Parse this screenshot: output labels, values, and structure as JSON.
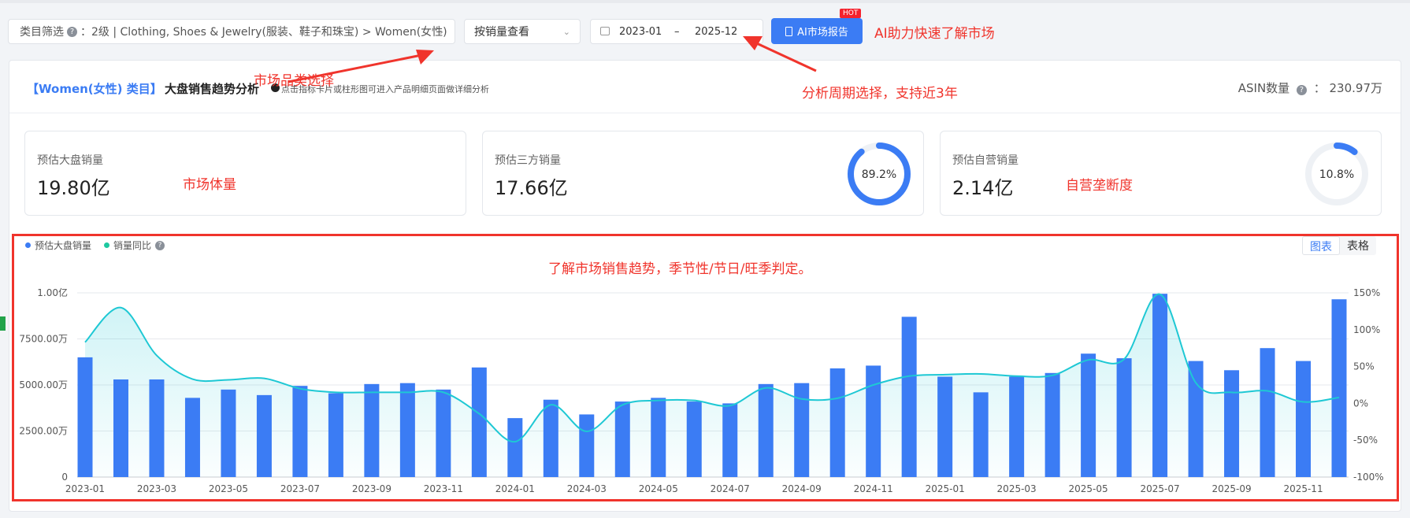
{
  "filter": {
    "label": "类目筛选",
    "help": "?",
    "value": "：2级 | Clothing, Shoes & Jewelry(服装、鞋子和珠宝) > Women(女性)",
    "chevron": "›"
  },
  "view_select": {
    "value": "按销量查看",
    "chevron": "⌄"
  },
  "date_range": {
    "start": "2023-01",
    "sep": "–",
    "end": "2025-12"
  },
  "ai_button": {
    "label": "AI市场报告",
    "badge": "HOT"
  },
  "annotations": {
    "ai": "AI助力快速了解市场",
    "category": "市场品类选择",
    "period": "分析周期选择，支持近3年",
    "volume": "市场体量",
    "self": "自营垄断度",
    "trend": "了解市场销售趋势，季节性/节日/旺季判定。"
  },
  "panel": {
    "category_tag": "【Women(女性) 类目】",
    "title": "大盘销售趋势分析",
    "hint": "点击指标卡片或柱形图可进入产品明细页面做详细分析",
    "asin_label": "ASIN数量",
    "asin_value": "：  230.97万"
  },
  "cards": [
    {
      "label": "预估大盘销量",
      "value": "19.80亿"
    },
    {
      "label": "预估三方销量",
      "value": "17.66亿",
      "ring": "89.2%",
      "ring_fraction": 0.892
    },
    {
      "label": "预估自营销量",
      "value": "2.14亿",
      "ring": "10.8%",
      "ring_fraction": 0.108
    }
  ],
  "legend": {
    "bars": "预估大盘销量",
    "line": "销量同比",
    "help": "?"
  },
  "tabs": {
    "chart": "图表",
    "table": "表格"
  },
  "colors": {
    "accent": "#3b7cf4",
    "line": "#1ec8d4",
    "annotation": "#f0342c",
    "badge": "#f5222d"
  },
  "chart_data": {
    "type": "bar",
    "x": [
      "2023-01",
      "2023-02",
      "2023-03",
      "2023-04",
      "2023-05",
      "2023-06",
      "2023-07",
      "2023-08",
      "2023-09",
      "2023-10",
      "2023-11",
      "2023-12",
      "2024-01",
      "2024-02",
      "2024-03",
      "2024-04",
      "2024-05",
      "2024-06",
      "2024-07",
      "2024-08",
      "2024-09",
      "2024-10",
      "2024-11",
      "2024-12",
      "2025-01",
      "2025-02",
      "2025-03",
      "2025-04",
      "2025-05",
      "2025-06",
      "2025-07",
      "2025-08",
      "2025-09",
      "2025-10",
      "2025-11",
      "2025-12"
    ],
    "x_tick_labels": [
      "2023-01",
      "2023-03",
      "2023-05",
      "2023-07",
      "2023-09",
      "2023-11",
      "2024-01",
      "2024-03",
      "2024-05",
      "2024-07",
      "2024-09",
      "2024-11",
      "2025-01",
      "2025-03",
      "2025-05",
      "2025-07",
      "2025-09",
      "2025-11"
    ],
    "series": [
      {
        "name": "预估大盘销量",
        "type": "bar",
        "unit": "万",
        "values": [
          6500,
          5300,
          5300,
          4300,
          4750,
          4450,
          4950,
          4550,
          5050,
          5100,
          4750,
          5950,
          3200,
          4200,
          3400,
          4100,
          4300,
          4100,
          4000,
          5050,
          5100,
          5900,
          6050,
          8700,
          5450,
          4600,
          5450,
          5650,
          6700,
          6450,
          9950,
          6300,
          5800,
          7000,
          6300,
          9650
        ]
      },
      {
        "name": "销量同比",
        "type": "line",
        "unit": "%",
        "axis": "right",
        "values": [
          83,
          130,
          65,
          33,
          32,
          34,
          20,
          15,
          15,
          15,
          15,
          -14,
          -52,
          -2,
          -38,
          -2,
          4,
          4,
          -3,
          21,
          6,
          7,
          25,
          37,
          39,
          40,
          37,
          38,
          59,
          60,
          148,
          28,
          15,
          17,
          2,
          8
        ]
      }
    ],
    "y_left": {
      "ticks": [
        "0",
        "2500.00万",
        "5000.00万",
        "7500.00万",
        "1.00亿"
      ],
      "range": [
        0,
        10000
      ]
    },
    "y_right": {
      "ticks": [
        "-100%",
        "-50%",
        "0%",
        "50%",
        "100%",
        "150%"
      ],
      "range": [
        -100,
        150
      ]
    },
    "grid": true,
    "legend_position": "top-left"
  }
}
